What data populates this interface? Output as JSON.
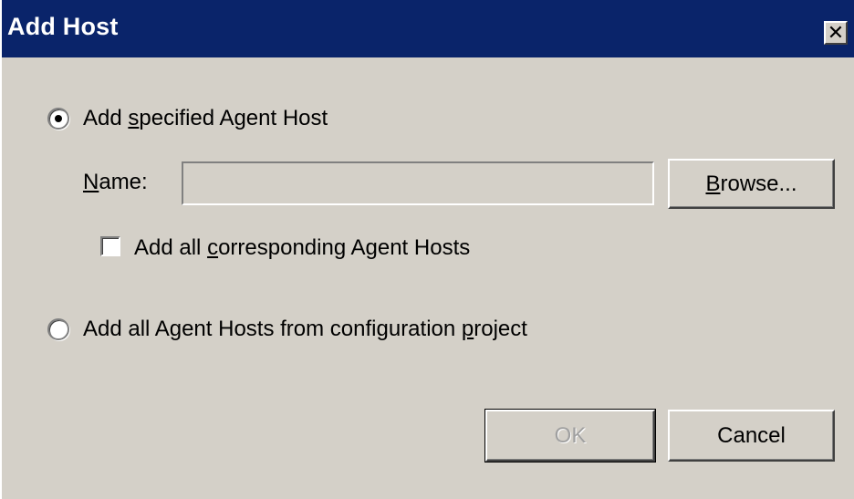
{
  "window": {
    "title": "Add Host",
    "close_glyph": "✕"
  },
  "options": {
    "specified": {
      "label_pre": "Add ",
      "label_mnemonic": "s",
      "label_post": "pecified Agent Host",
      "selected": true
    },
    "all_from_project": {
      "label_pre": "Add all Agent Hosts from configuration ",
      "label_mnemonic": "p",
      "label_post": "roject",
      "selected": false
    }
  },
  "name_field": {
    "label_mnemonic": "N",
    "label_post": "ame:",
    "value": ""
  },
  "browse_button": {
    "label_mnemonic": "B",
    "label_post": "rowse..."
  },
  "corresponding_checkbox": {
    "label_pre": "Add all ",
    "label_mnemonic": "c",
    "label_post": "orresponding Agent Hosts",
    "checked": false
  },
  "buttons": {
    "ok": "OK",
    "cancel": "Cancel"
  },
  "icons": {
    "close": "close-icon"
  }
}
